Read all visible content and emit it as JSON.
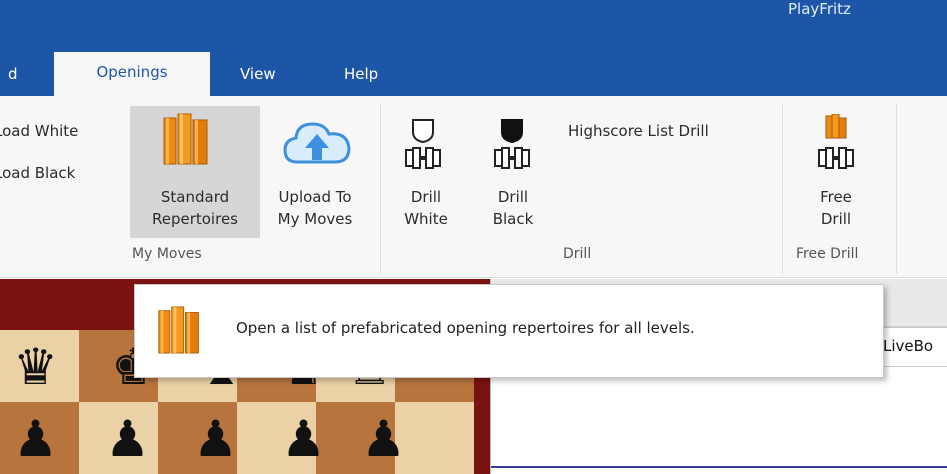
{
  "app": {
    "title": "PlayFritz"
  },
  "tabs": {
    "partial": "d",
    "openings": "Openings",
    "view": "View",
    "help": "Help"
  },
  "ribbon": {
    "load_white": "Load White",
    "load_black": "Load Black",
    "standard_line1": "Standard",
    "standard_line2": "Repertoires",
    "upload_line1": "Upload To",
    "upload_line2": "My Moves",
    "my_moves_group": "My Moves",
    "drill_white_line1": "Drill",
    "drill_white_line2": "White",
    "drill_black_line1": "Drill",
    "drill_black_line2": "Black",
    "highscore": "Highscore List Drill",
    "drill_group": "Drill",
    "free_drill_line1": "Free",
    "free_drill_line2": "Drill",
    "free_drill_group": "Free Drill"
  },
  "tooltip": {
    "text": "Open a list of prefabricated opening repertoires for all levels."
  },
  "right_panel": {
    "partial_text": "LiveBo"
  },
  "board": {
    "top_row": [
      "♛",
      "♚",
      "♝",
      "♞",
      "♜"
    ],
    "pawn_row": [
      "♟",
      "♟",
      "♟",
      "♟",
      "♟"
    ]
  },
  "colors": {
    "accent": "#1d56a6",
    "book_orange": "#f08a14",
    "cloud_blue": "#3d8fe0"
  }
}
